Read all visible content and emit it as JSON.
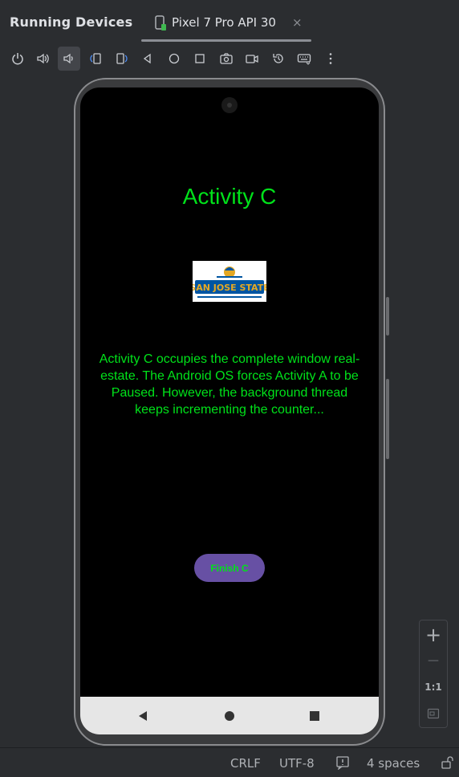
{
  "panel": {
    "title": "Running Devices"
  },
  "tab": {
    "label": "Pixel 7 Pro API 30",
    "close": "×"
  },
  "toolbar": {
    "buttons": [
      "power-icon",
      "volume-up-icon",
      "volume-down-icon",
      "rotate-left-icon",
      "rotate-right-icon",
      "back-icon",
      "home-icon",
      "overview-icon",
      "screenshot-icon",
      "screen-record-icon",
      "reset-icon",
      "keyboard-icon",
      "more-icon"
    ]
  },
  "app": {
    "title": "Activity C",
    "logo_text": "SAN JOSE STATE",
    "description": "Activity C occupies the complete window real-estate. The Android OS forces Activity A to be Paused. However, the background thread keeps incrementing the counter...",
    "button_label": "Finish C"
  },
  "zoom": {
    "in": "+",
    "out": "—",
    "actual": "1:1"
  },
  "status": {
    "line_sep": "CRLF",
    "encoding": "UTF-8",
    "indent": "4 spaces"
  },
  "colors": {
    "accent_text": "#00e21a",
    "button_bg": "#6750a4",
    "ide_bg": "#2b2d30"
  }
}
